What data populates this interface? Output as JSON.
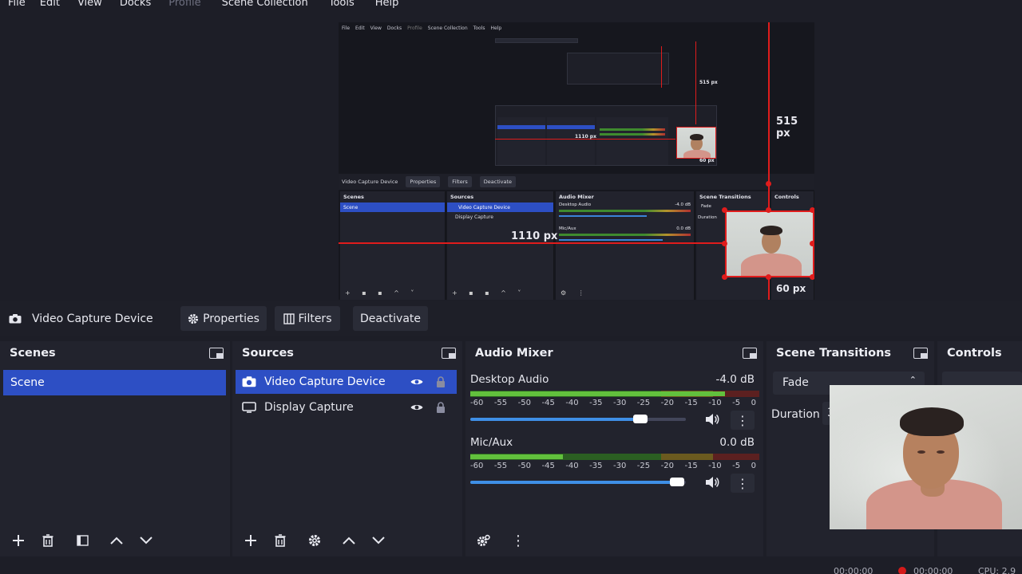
{
  "menubar": {
    "items": [
      "File",
      "Edit",
      "View",
      "Docks",
      "Profile",
      "Scene Collection",
      "Tools",
      "Help"
    ],
    "disabled_item": "Profile"
  },
  "preview": {
    "measure_vertical": "515 px",
    "measure_horizontal": "1110 px",
    "measure_bottom": "60 px",
    "mini_measure_vertical": "515 px",
    "mini_measure_horizontal": "1110 px",
    "mini_measure_bottom": "60 px",
    "mini_source_name": "Video Capture Device",
    "mini_properties": "Properties",
    "mini_filters": "Filters",
    "mini_deactivate": "Deactivate",
    "mini_scenes": "Scenes",
    "mini_sources": "Sources",
    "mini_audio_mixer": "Audio Mixer",
    "mini_scene_transitions": "Scene Transitions",
    "mini_controls": "Controls",
    "mini_scene": "Scene",
    "mini_src1": "Video Capture Device",
    "mini_src2": "Display Capture",
    "mini_desktop_audio": "Desktop Audio",
    "mini_mic_aux": "Mic/Aux",
    "mini_fade": "Fade",
    "mini_duration": "Duration",
    "mini_desktop_db": "-4.0 dB",
    "mini_mic_db": "0.0 dB"
  },
  "toolbar": {
    "source_name": "Video Capture Device",
    "properties_label": "Properties",
    "filters_label": "Filters",
    "deactivate_label": "Deactivate"
  },
  "scenes": {
    "title": "Scenes",
    "items": [
      "Scene"
    ]
  },
  "sources": {
    "title": "Sources",
    "items": [
      "Video Capture Device",
      "Display Capture"
    ]
  },
  "audio_mixer": {
    "title": "Audio Mixer",
    "tick_labels": [
      "-60",
      "-55",
      "-50",
      "-45",
      "-40",
      "-35",
      "-30",
      "-25",
      "-20",
      "-15",
      "-10",
      "-5",
      "0"
    ],
    "channels": [
      {
        "name": "Desktop Audio",
        "db": "-4.0 dB",
        "level": 0.88,
        "volume": 0.79
      },
      {
        "name": "Mic/Aux",
        "db": "0.0 dB",
        "level": 0.32,
        "volume": 0.96
      }
    ]
  },
  "transitions": {
    "title": "Scene Transitions",
    "selected": "Fade",
    "duration_label": "Duration",
    "duration_value": "3"
  },
  "controls": {
    "title": "Controls"
  },
  "statusbar": {
    "stream_time": "00:00:00",
    "rec_time": "00:00:00",
    "cpu": "CPU: 2.9"
  },
  "colors": {
    "accent": "#2d4fc4",
    "guide_red": "#e01c1c",
    "panel": "#22232d",
    "background": "#1d1e27"
  }
}
